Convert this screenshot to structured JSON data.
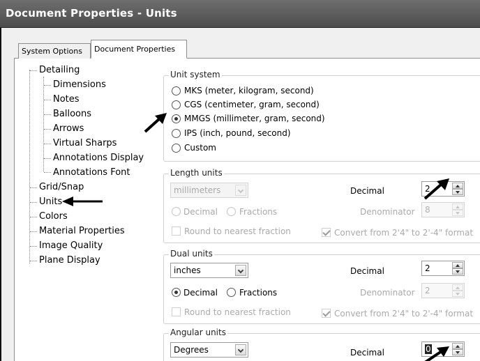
{
  "window": {
    "title": "Document Properties - Units"
  },
  "tabs": [
    {
      "label": "System Options"
    },
    {
      "label": "Document Properties"
    }
  ],
  "tree": {
    "items": [
      {
        "label": "Detailing"
      },
      {
        "label": "Dimensions"
      },
      {
        "label": "Notes"
      },
      {
        "label": "Balloons"
      },
      {
        "label": "Arrows"
      },
      {
        "label": "Virtual Sharps"
      },
      {
        "label": "Annotations Display"
      },
      {
        "label": "Annotations Font"
      },
      {
        "label": "Grid/Snap"
      },
      {
        "label": "Units"
      },
      {
        "label": "Colors"
      },
      {
        "label": "Material Properties"
      },
      {
        "label": "Image Quality"
      },
      {
        "label": "Plane Display"
      }
    ]
  },
  "unit_system": {
    "legend": "Unit system",
    "options": [
      {
        "label": "MKS  (meter, kilogram, second)"
      },
      {
        "label": "CGS  (centimeter, gram, second)"
      },
      {
        "label": "MMGS (millimeter, gram, second)"
      },
      {
        "label": "IPS  (inch, pound, second)"
      },
      {
        "label": "Custom"
      }
    ],
    "selected": "MMGS (millimeter, gram, second)"
  },
  "length_units": {
    "legend": "Length units",
    "unit": "millimeters",
    "decimal_label": "Decimal",
    "decimal_value": "2",
    "decimal_radio": "Decimal",
    "fractions_radio": "Fractions",
    "denominator_label": "Denominator",
    "denominator_value": "8",
    "round_label": "Round to nearest fraction",
    "convert_label": "Convert from 2'4\" to 2'-4\" format"
  },
  "dual_units": {
    "legend": "Dual units",
    "unit": "inches",
    "decimal_label": "Decimal",
    "decimal_value": "2",
    "decimal_radio": "Decimal",
    "fractions_radio": "Fractions",
    "denominator_label": "Denominator",
    "denominator_value": "2",
    "round_label": "Round to nearest fraction",
    "convert_label": "Convert from 2'4\" to 2'-4\" format"
  },
  "angular_units": {
    "legend": "Angular units",
    "unit": "Degrees",
    "decimal_label": "Decimal",
    "decimal_value": "0"
  },
  "icons": {
    "pointer": "pointer-arrow-icon"
  }
}
